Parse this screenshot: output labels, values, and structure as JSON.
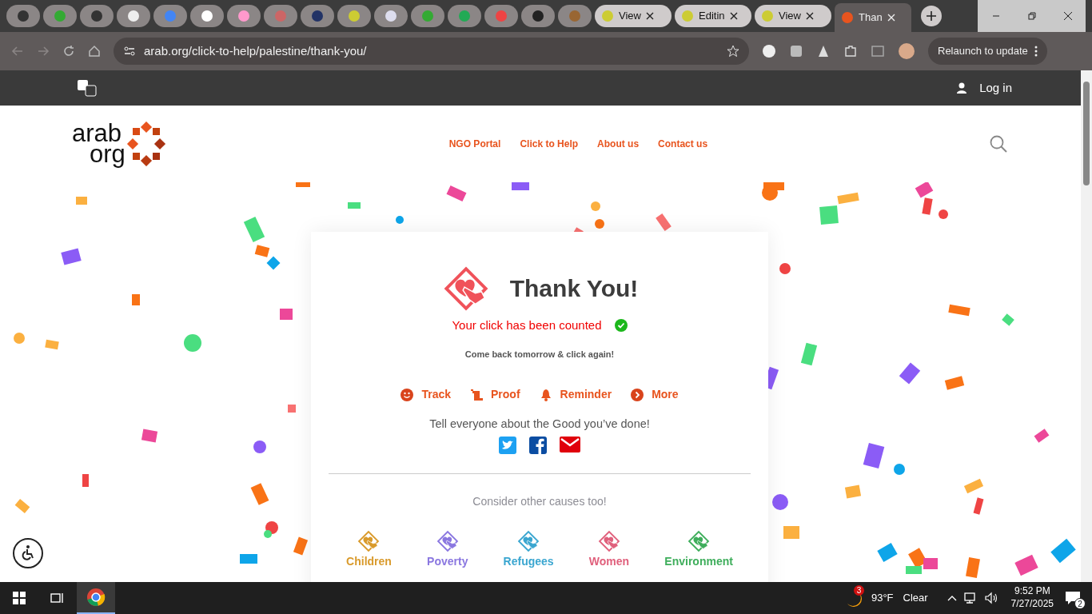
{
  "browser": {
    "tabs": [
      {
        "selected": false
      },
      {
        "selected": false
      },
      {
        "selected": false
      },
      {
        "selected": false
      },
      {
        "selected": false
      },
      {
        "selected": false
      },
      {
        "selected": false
      },
      {
        "selected": false
      },
      {
        "selected": false
      },
      {
        "selected": false
      },
      {
        "selected": false
      },
      {
        "selected": false
      },
      {
        "selected": false
      },
      {
        "selected": false
      },
      {
        "selected": false
      },
      {
        "selected": false
      },
      {
        "title": "View",
        "selected": false
      },
      {
        "title": "Editin",
        "selected": false
      },
      {
        "title": "View",
        "selected": false
      },
      {
        "title": "Than",
        "selected": true
      }
    ],
    "address": "arab.org/click-to-help/palestine/thank-you/",
    "relaunch": "Relaunch to update"
  },
  "site": {
    "login": "Log in",
    "logo": {
      "line1": "arab",
      "line2": "org"
    },
    "nav": [
      "NGO Portal",
      "Click to Help",
      "About us",
      "Contact us"
    ]
  },
  "card": {
    "title": "Thank You!",
    "status": "Your click has been counted",
    "subtitle": "Come back tomorrow & click again!",
    "actions": [
      {
        "kind": "track",
        "label": "Track"
      },
      {
        "kind": "proof",
        "label": "Proof"
      },
      {
        "kind": "reminder",
        "label": "Reminder"
      },
      {
        "kind": "more",
        "label": "More"
      }
    ],
    "share_text": "Tell everyone about the Good you’ve done!",
    "causes_heading": "Consider other causes too!",
    "causes": [
      {
        "label": "Children",
        "color": "#d99a2b"
      },
      {
        "label": "Poverty",
        "color": "#8a77e0"
      },
      {
        "label": "Refugees",
        "color": "#3aa6d0"
      },
      {
        "label": "Women",
        "color": "#e0607c"
      },
      {
        "label": "Environment",
        "color": "#3fae5c"
      }
    ]
  },
  "taskbar": {
    "weather_badge": "3",
    "temperature": "93°F",
    "condition": "Clear",
    "time": "9:52 PM",
    "date": "7/27/2025",
    "notifications": "2"
  }
}
